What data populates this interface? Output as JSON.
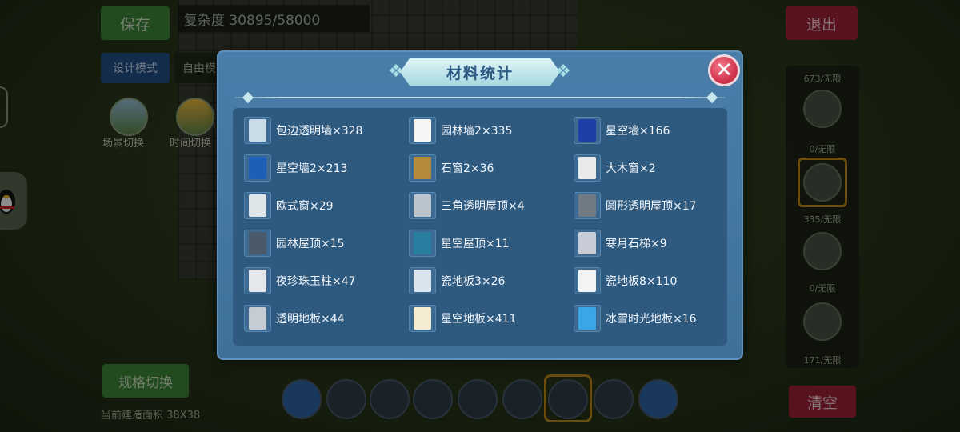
{
  "hud": {
    "save_label": "保存",
    "complexity_text": "复杂度 30895/58000",
    "design_mode_label": "设计模式",
    "free_mode_label": "自由模",
    "scene_switch_label": "场景切换",
    "time_switch_label": "时间切换",
    "exit_label": "退出",
    "clear_label": "清空",
    "spec_switch_label": "规格切换",
    "build_area_text": "当前建造面积 38X38"
  },
  "right_panel": {
    "counts": [
      "673/无限",
      "0/无限",
      "335/无限",
      "0/无限",
      "171/无限"
    ]
  },
  "modal": {
    "title": "材料统计",
    "close_symbol": "✕",
    "items": [
      {
        "label": "包边透明墙×328",
        "icon": "transparent-wall-icon",
        "color": "#c9dbe6"
      },
      {
        "label": "园林墙2×335",
        "icon": "garden-wall-icon",
        "color": "#f4f7f6"
      },
      {
        "label": "星空墙×166",
        "icon": "starry-wall-icon",
        "color": "#1f3fa8"
      },
      {
        "label": "星空墙2×213",
        "icon": "starry-wall-2-icon",
        "color": "#1d5fb8"
      },
      {
        "label": "石窗2×36",
        "icon": "stone-window-icon",
        "color": "#b58a3a"
      },
      {
        "label": "大木窗×2",
        "icon": "large-wood-window-icon",
        "color": "#e8ebe9"
      },
      {
        "label": "欧式窗×29",
        "icon": "european-window-icon",
        "color": "#dfe6ea"
      },
      {
        "label": "三角透明屋顶×4",
        "icon": "triangle-roof-icon",
        "color": "#b9c4cc"
      },
      {
        "label": "圆形透明屋顶×17",
        "icon": "round-roof-icon",
        "color": "#6f7a83"
      },
      {
        "label": "园林屋顶×15",
        "icon": "garden-roof-icon",
        "color": "#4a5a6b"
      },
      {
        "label": "星空屋顶×11",
        "icon": "starry-roof-icon",
        "color": "#2a7fa0"
      },
      {
        "label": "寒月石梯×9",
        "icon": "cold-moon-stairs-icon",
        "color": "#c7ccd6"
      },
      {
        "label": "夜珍珠玉柱×47",
        "icon": "pearl-pillar-icon",
        "color": "#e4e8ec"
      },
      {
        "label": "瓷地板3×26",
        "icon": "tile-floor-3-icon",
        "color": "#d8e4ee"
      },
      {
        "label": "瓷地板8×110",
        "icon": "tile-floor-8-icon",
        "color": "#f1f3f4"
      },
      {
        "label": "透明地板×44",
        "icon": "transparent-floor-icon",
        "color": "#c4ccd4"
      },
      {
        "label": "星空地板×411",
        "icon": "starry-floor-icon",
        "color": "#f4ecd2"
      },
      {
        "label": "冰雪时光地板×16",
        "icon": "ice-snow-floor-icon",
        "color": "#3aa6e6"
      }
    ]
  }
}
